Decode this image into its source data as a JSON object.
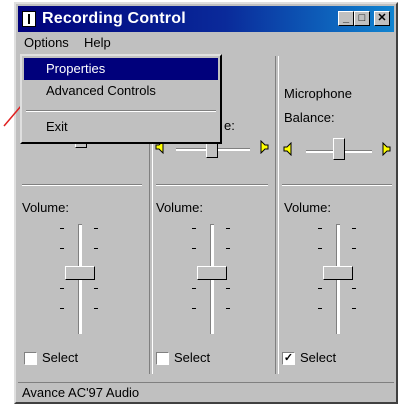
{
  "window": {
    "title": "Recording Control"
  },
  "menubar": {
    "options": "Options",
    "help": "Help"
  },
  "dropdown": {
    "items": [
      "Properties",
      "Advanced Controls",
      "Exit"
    ]
  },
  "panels": [
    {
      "header": "",
      "balance_label": "",
      "volume_label": "Volume:",
      "select_label": "Select",
      "checked": false
    },
    {
      "header": "",
      "balance_label": "e:",
      "volume_label": "Volume:",
      "select_label": "Select",
      "checked": false
    },
    {
      "header": "Microphone",
      "balance_label": "Balance:",
      "volume_label": "Volume:",
      "select_label": "Select",
      "checked": true
    }
  ],
  "statusbar": {
    "text": "Avance AC'97 Audio"
  },
  "colors": {
    "titlebar": "#00007b",
    "face": "#c0c0c0",
    "highlight": "#00007b",
    "annotation_arrow": "#e02020"
  },
  "icons": {
    "close": "close-icon",
    "minimize": "minimize-icon",
    "maximize": "maximize-icon",
    "speaker": "speaker-icon"
  }
}
